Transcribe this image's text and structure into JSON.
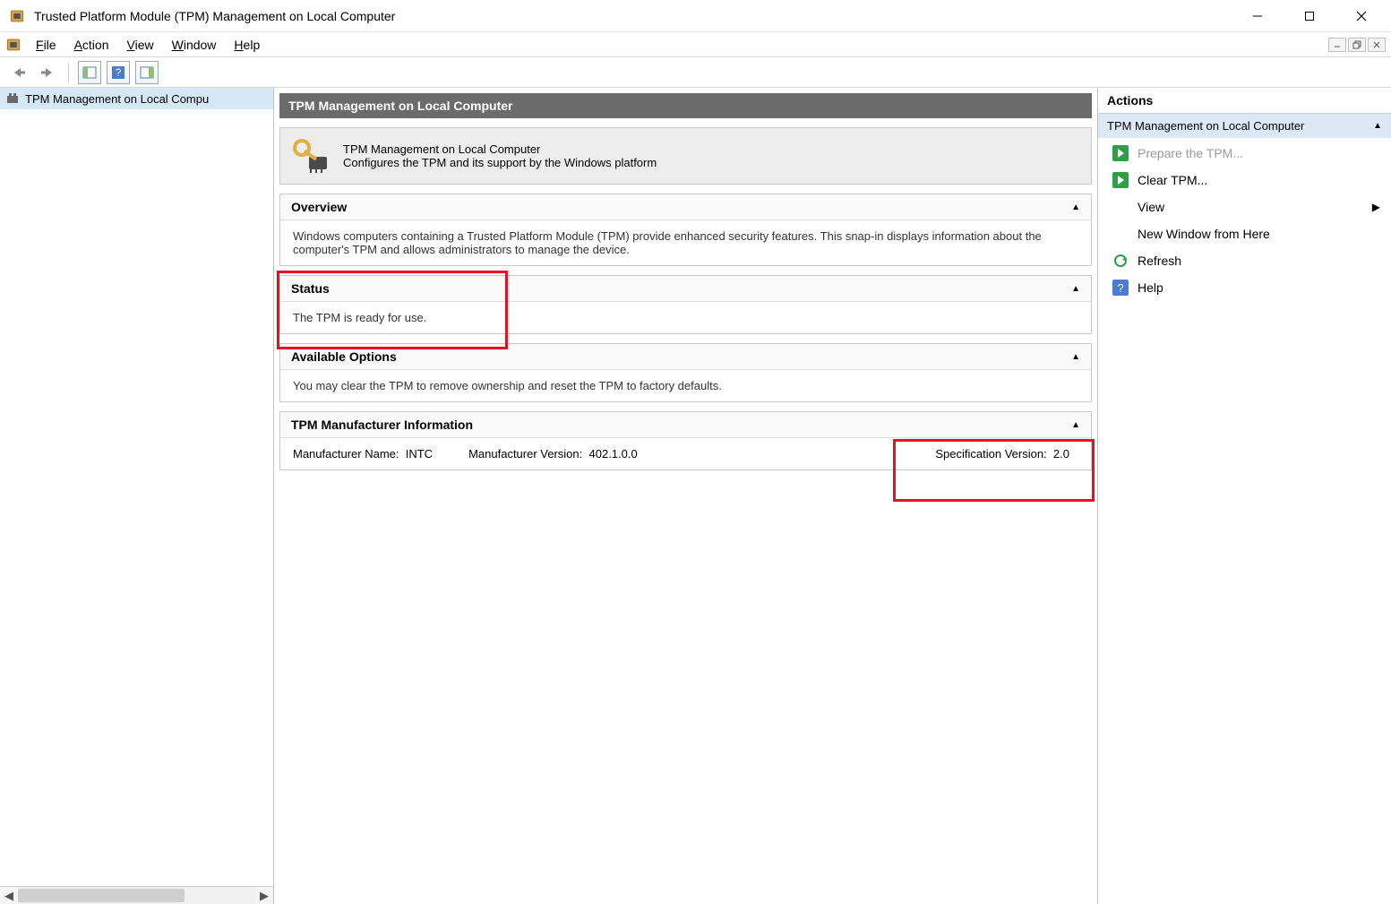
{
  "window": {
    "title": "Trusted Platform Module (TPM) Management on Local Computer"
  },
  "menubar": {
    "file": "File",
    "action": "Action",
    "view": "View",
    "window": "Window",
    "help": "Help"
  },
  "tree": {
    "item0": "TPM Management on Local Compu"
  },
  "center": {
    "header": "TPM Management on Local Computer",
    "intro_title": "TPM Management on Local Computer",
    "intro_desc": "Configures the TPM and its support by the Windows platform",
    "overview_title": "Overview",
    "overview_body": "Windows computers containing a Trusted Platform Module (TPM) provide enhanced security features. This snap-in displays information about the computer's TPM and allows administrators to manage the device.",
    "status_title": "Status",
    "status_body": "The TPM is ready for use.",
    "options_title": "Available Options",
    "options_body": "You may clear the TPM to remove ownership and reset the TPM to factory defaults.",
    "mfr_title": "TPM Manufacturer Information",
    "mfr_name_label": "Manufacturer Name:",
    "mfr_name_value": "INTC",
    "mfr_ver_label": "Manufacturer Version:",
    "mfr_ver_value": "402.1.0.0",
    "spec_ver_label": "Specification Version:",
    "spec_ver_value": "2.0"
  },
  "actions": {
    "title": "Actions",
    "subtitle": "TPM Management on Local Computer",
    "prepare": "Prepare the TPM...",
    "clear": "Clear TPM...",
    "view": "View",
    "newwin": "New Window from Here",
    "refresh": "Refresh",
    "help": "Help"
  }
}
